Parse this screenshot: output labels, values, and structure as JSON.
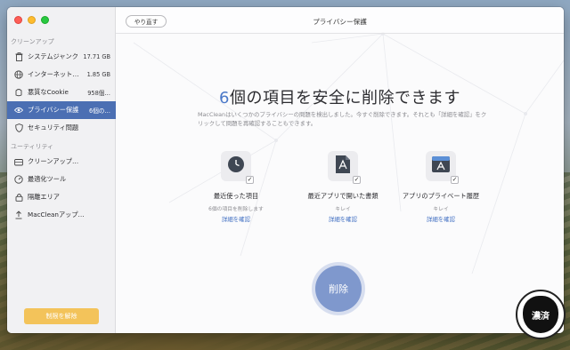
{
  "window": {
    "title": "プライバシー保護"
  },
  "toolbar": {
    "redo_label": "やり直す"
  },
  "sidebar": {
    "section_cleanup": "クリーンアップ",
    "section_utilities": "ユーティリティ",
    "cleanup_items": [
      {
        "icon": "trash-icon",
        "label": "システムジャンク",
        "value": "17.71 GB"
      },
      {
        "icon": "globe-icon",
        "label": "インターネット…",
        "value": "1.85 GB"
      },
      {
        "icon": "cookie-icon",
        "label": "悪質なCookie",
        "value": "958個…"
      },
      {
        "icon": "eye-icon",
        "label": "プライバシー保護",
        "value": "6個の…",
        "active": true
      },
      {
        "icon": "shield-icon",
        "label": "セキュリティ問題",
        "value": ""
      }
    ],
    "utility_items": [
      {
        "icon": "drive-icon",
        "label": "クリーンアップ…"
      },
      {
        "icon": "gauge-icon",
        "label": "最適化ツール"
      },
      {
        "icon": "lock-icon",
        "label": "隔離エリア"
      },
      {
        "icon": "upload-icon",
        "label": "MacCleanアップ…"
      }
    ],
    "unlock_label": "制限を解除"
  },
  "main": {
    "headline_count": "6",
    "headline_text": "個の項目を安全に削除できます",
    "description": "MacCleanはいくつかのプライバシーの問題を検出しました。今すぐ削除できます。それとも「詳細を確認」をクリックして問題を再確認することもできます。",
    "cards": [
      {
        "icon": "clock-icon",
        "title": "最近使った項目",
        "subtitle": "6個の項目を削除します",
        "link": "詳細を確認"
      },
      {
        "icon": "document-icon",
        "title": "最近アプリで開いた書類",
        "subtitle": "キレイ",
        "link": "詳細を確認"
      },
      {
        "icon": "app-icon",
        "title": "アプリのプライベート履歴",
        "subtitle": "キレイ",
        "link": "詳細を確認"
      }
    ],
    "delete_label": "削除"
  },
  "watermark": {
    "text": "濃済"
  },
  "colors": {
    "accent": "#4b6fb3",
    "link": "#3d6cc1",
    "unlock": "#f3c35a",
    "delete": "#7f98cd"
  }
}
